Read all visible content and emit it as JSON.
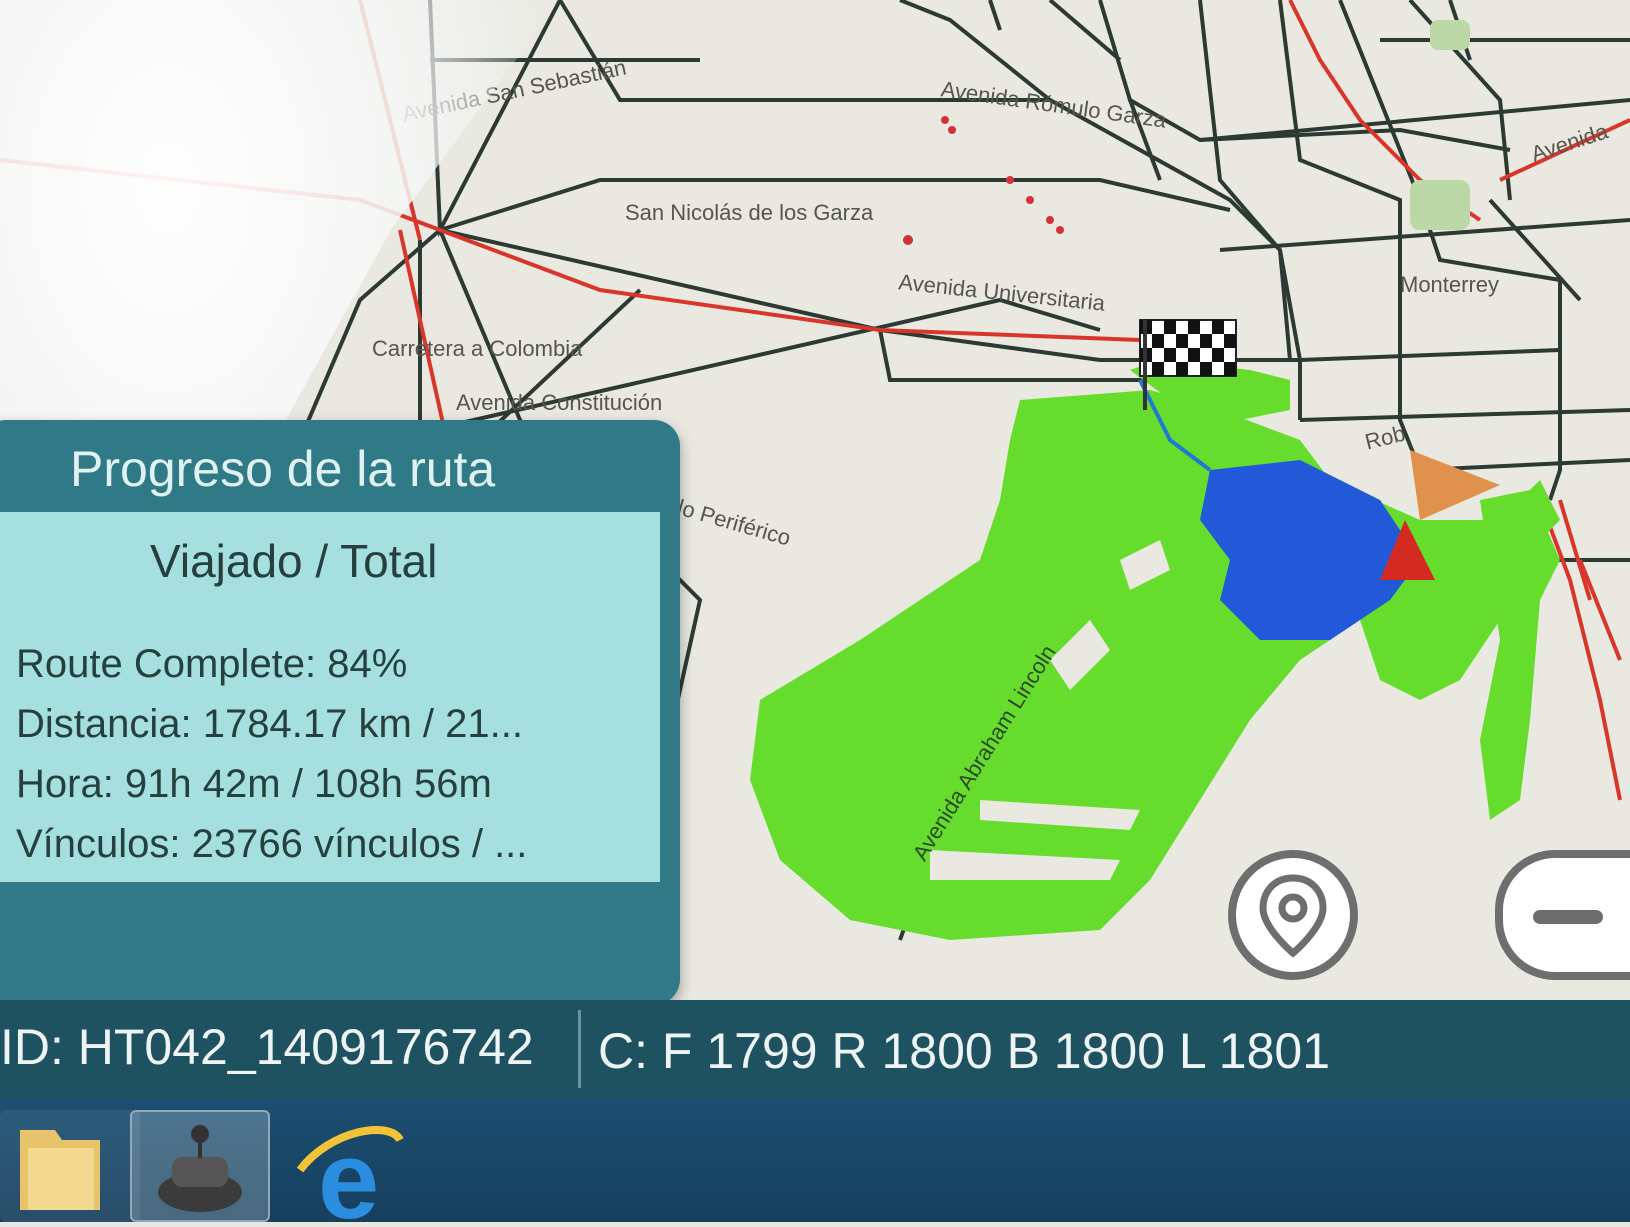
{
  "map": {
    "labels": [
      "Avenida San Sebastián",
      "Avenida Rómulo Garza",
      "San Nicolás de los Garza",
      "Avenida Universitaria",
      "Carretera a Colombia",
      "Avenida Constitución",
      "Anillo Periférico",
      "Monterrey",
      "Rob",
      "Avenida",
      "Avenida Abraham Lincoln"
    ],
    "icons": {
      "destination": "checkered-flag-icon",
      "vehicle": "vehicle-cursor-icon",
      "pin": "location-pin-icon",
      "zoom_out": "minus-icon"
    },
    "colors": {
      "covered_area": "#66dd2c",
      "current_area": "#2159d8",
      "primary_road": "#d9362b",
      "road": "#2d3a34"
    }
  },
  "progress": {
    "title": "Progreso de la ruta",
    "header": "Viajado / Total",
    "route_complete": "Route Complete: 84%",
    "distance": "Distancia: 1784.17 km / 21...",
    "time": "Hora: 91h 42m / 108h 56m",
    "links": "Vínculos: 23766 vínculos / ..."
  },
  "status_bar": {
    "id": "ID: HT042_1409176742",
    "counts": "C: F 1799 R 1800 B 1800 L 1801"
  },
  "taskbar": {
    "apps": [
      "folder-icon",
      "vehicle-app-icon",
      "internet-explorer-icon"
    ]
  }
}
